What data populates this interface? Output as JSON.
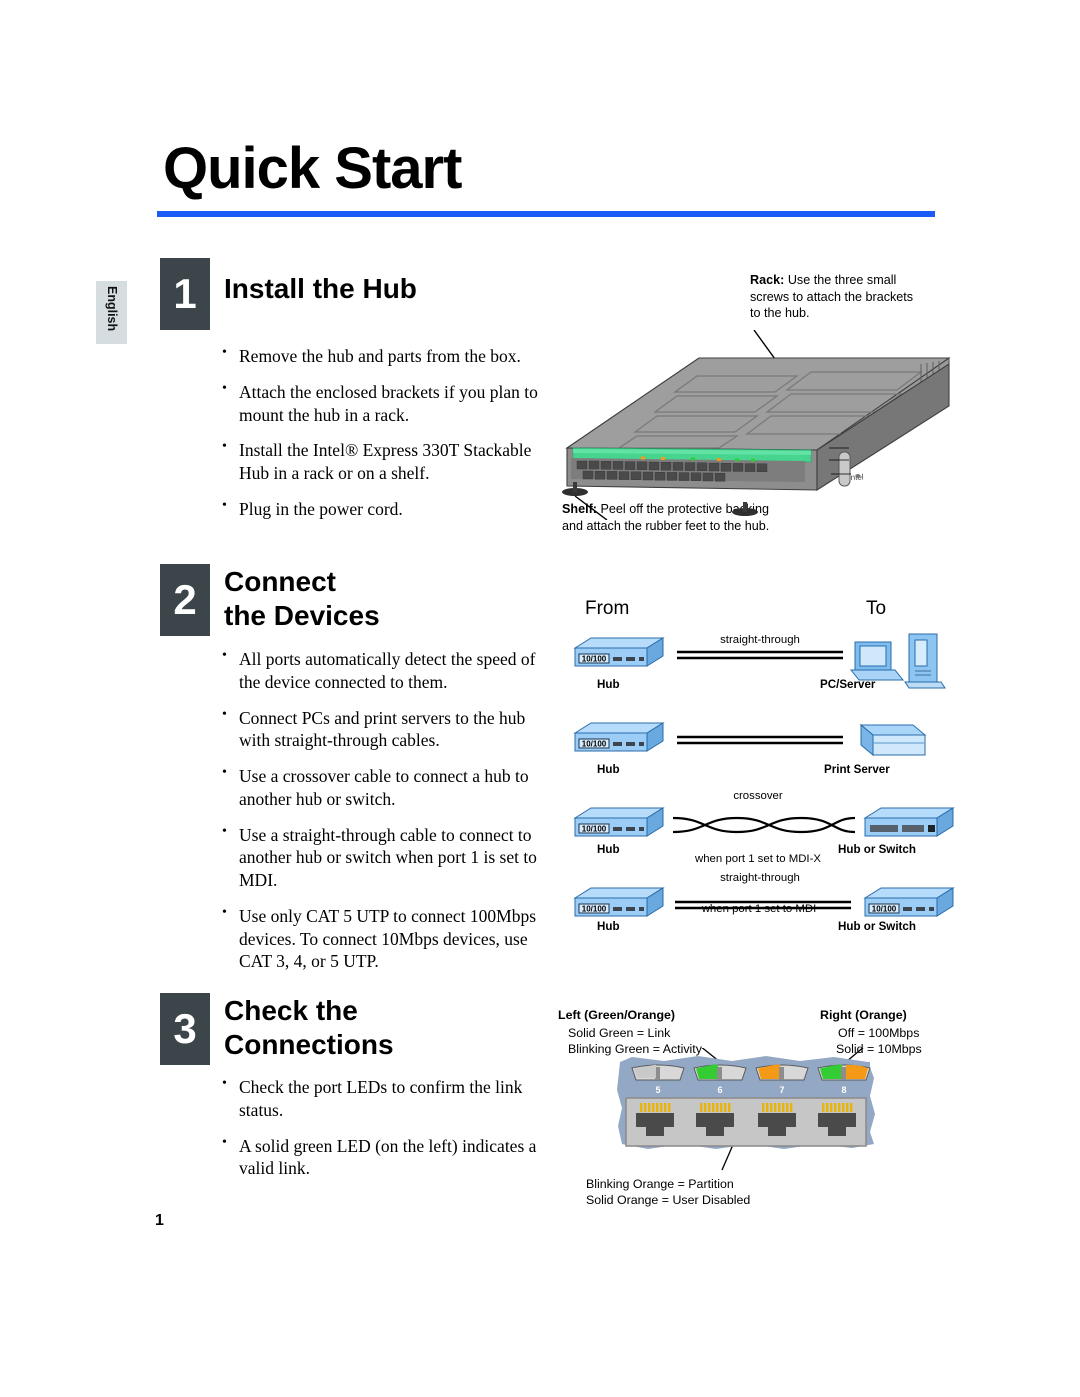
{
  "document": {
    "title": "Quick Start",
    "language_tab": "English",
    "page_number": "1"
  },
  "colors": {
    "rule_blue": "#1a5cf5",
    "step_box": "#3b454a",
    "tab_gray": "#d5dde0",
    "device_blue": "#8fc4f0",
    "led_green": "#33cc33",
    "led_orange": "#f49a17"
  },
  "steps": [
    {
      "number": "1",
      "title": "Install the Hub",
      "bullets": [
        "Remove the hub and parts from the box.",
        "Attach the enclosed brackets if you plan to mount the hub in a rack.",
        "Install the Intel® Express 330T Stackable Hub in a rack or on a shelf.",
        "Plug in the power cord."
      ]
    },
    {
      "number": "2",
      "title_line1": "Connect",
      "title_line2": "the Devices",
      "bullets": [
        "All ports automatically detect the speed of the device connected to them.",
        "Connect PCs and print servers to the hub with straight-through cables.",
        "Use a crossover cable to connect a hub to another hub or switch.",
        "Use a straight-through cable to connect to another hub or switch when port 1 is set to MDI.",
        "Use only CAT 5 UTP to connect 100Mbps devices. To connect 10Mbps devices, use CAT 3, 4, or 5 UTP."
      ]
    },
    {
      "number": "3",
      "title_line1": "Check the",
      "title_line2": "Connections",
      "bullets": [
        "Check the port LEDs to confirm the link status.",
        "A solid green LED (on the left) indicates a valid link."
      ]
    }
  ],
  "install_illustration": {
    "rack_callout_bold": "Rack:",
    "rack_callout_text": "Use the three small screws to attach the brackets to the hub.",
    "shelf_callout_bold": "Shelf:",
    "shelf_callout_text": "Peel off the protective backing and attach the rubber feet to the hub.",
    "hub_brand": "intel"
  },
  "connection_diagram": {
    "from_header": "From",
    "to_header": "To",
    "hub_badge": "10/100",
    "rows": [
      {
        "from_label": "Hub",
        "cable_type": "straight-through",
        "cable_note": "",
        "to_label": "PC/Server",
        "cable_style": "straight"
      },
      {
        "from_label": "Hub",
        "cable_type": "",
        "cable_note": "",
        "to_label": "Print Server",
        "cable_style": "straight"
      },
      {
        "from_label": "Hub",
        "cable_type": "crossover",
        "cable_note": "when port 1 set to MDI-X",
        "to_label": "Hub or Switch",
        "cable_style": "crossover"
      },
      {
        "from_label": "Hub",
        "cable_type": "straight-through",
        "cable_note": "when port 1 set to MDI",
        "to_label": "Hub or Switch",
        "cable_style": "straight"
      }
    ]
  },
  "led_diagram": {
    "left_header": "Left (Green/Orange)",
    "left_lines": [
      "Solid Green  = Link",
      "Blinking Green = Activity"
    ],
    "right_header": "Right (Orange)",
    "right_lines": [
      "Off = 100Mbps",
      "Solid = 10Mbps"
    ],
    "bottom_lines": [
      "Blinking Orange = Partition",
      "Solid Orange = User Disabled"
    ],
    "port_numbers": [
      "5",
      "6",
      "7",
      "8"
    ],
    "port_led_states": [
      {
        "left": "off",
        "right": "off"
      },
      {
        "left": "green",
        "right": "off"
      },
      {
        "left": "orange",
        "right": "off"
      },
      {
        "left": "green",
        "right": "orange"
      }
    ]
  }
}
